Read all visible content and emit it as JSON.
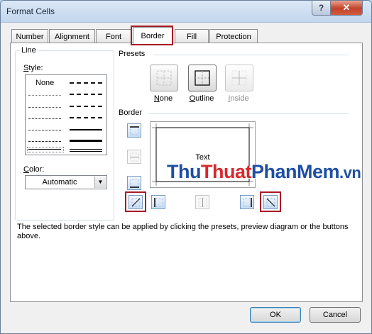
{
  "window": {
    "title": "Format Cells",
    "help_glyph": "?",
    "close_glyph": "✕"
  },
  "tabs": [
    {
      "label": "Number"
    },
    {
      "label": "Alignment"
    },
    {
      "label": "Font"
    },
    {
      "label": "Border"
    },
    {
      "label": "Fill"
    },
    {
      "label": "Protection"
    }
  ],
  "active_tab": "Border",
  "line": {
    "group_label": "Line",
    "style_label_prefix": "S",
    "style_label_rest": "tyle:",
    "style_none": "None",
    "color_label_prefix": "C",
    "color_label_rest": "olor:",
    "color_value": "Automatic"
  },
  "presets": {
    "label": "Presets",
    "items": [
      {
        "label_prefix": "N",
        "label_rest": "one",
        "enabled": true
      },
      {
        "label_prefix": "O",
        "label_rest": "utline",
        "enabled": true
      },
      {
        "label_prefix": "I",
        "label_rest": "nside",
        "enabled": false
      }
    ]
  },
  "border": {
    "label": "Border",
    "preview_text": "Text"
  },
  "description": "The selected border style can be applied by clicking the presets, preview diagram or the buttons above.",
  "buttons": {
    "ok": "OK",
    "cancel": "Cancel"
  },
  "watermark": {
    "part1": "Thu",
    "part2": "Thuat",
    "part3": "PhanMem",
    "part4": ".vn"
  },
  "colors": {
    "accent_red": "#a71b26",
    "watermark_blue": "#1f4fa3",
    "watermark_red": "#d8282d"
  }
}
